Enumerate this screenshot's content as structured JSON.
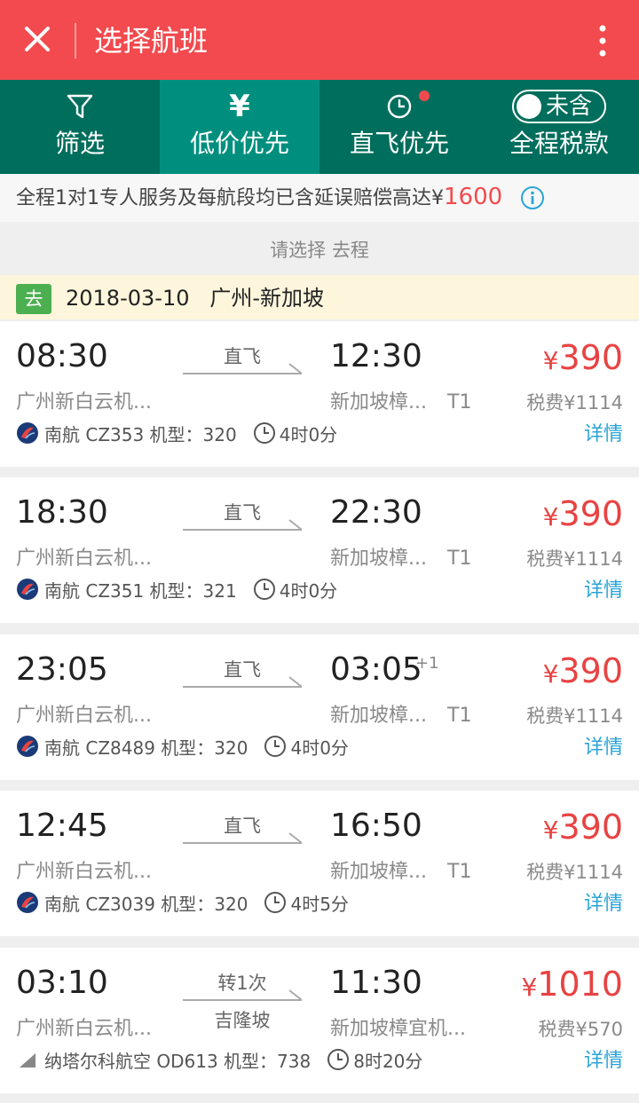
{
  "header": {
    "title": "选择航班"
  },
  "tabs": [
    {
      "label": "筛选",
      "icon": "filter-icon"
    },
    {
      "label": "低价优先",
      "icon": "yen-icon",
      "glyph": "¥"
    },
    {
      "label": "直飞优先",
      "icon": "clock-icon"
    },
    {
      "label": "全程税款",
      "toggle_label": "未含"
    }
  ],
  "notice": {
    "text": "全程1对1专人服务及每航段均已含延误赔偿高达¥",
    "amount": "1600"
  },
  "section_label": "请选择 去程",
  "route": {
    "badge": "去",
    "text": "2018-03-10   广州-新加坡"
  },
  "flights": [
    {
      "dep_time": "08:30",
      "arr_time": "12:30",
      "plus": "",
      "dep_airport": "广州新白云机...",
      "arr_airport": "新加坡樟...",
      "terminal": "T1",
      "mid_top": "直飞",
      "mid_bottom": "",
      "currency": "¥",
      "price": "390",
      "tax": "税费¥1114",
      "airline": "南航",
      "flight_no": "CZ353 机型：320",
      "duration": "4时0分",
      "detail": "详情"
    },
    {
      "dep_time": "18:30",
      "arr_time": "22:30",
      "plus": "",
      "dep_airport": "广州新白云机...",
      "arr_airport": "新加坡樟...",
      "terminal": "T1",
      "mid_top": "直飞",
      "mid_bottom": "",
      "currency": "¥",
      "price": "390",
      "tax": "税费¥1114",
      "airline": "南航",
      "flight_no": "CZ351 机型：321",
      "duration": "4时0分",
      "detail": "详情"
    },
    {
      "dep_time": "23:05",
      "arr_time": "03:05",
      "plus": "+1",
      "dep_airport": "广州新白云机...",
      "arr_airport": "新加坡樟...",
      "terminal": "T1",
      "mid_top": "直飞",
      "mid_bottom": "",
      "currency": "¥",
      "price": "390",
      "tax": "税费¥1114",
      "airline": "南航",
      "flight_no": "CZ8489 机型：320",
      "duration": "4时0分",
      "detail": "详情"
    },
    {
      "dep_time": "12:45",
      "arr_time": "16:50",
      "plus": "",
      "dep_airport": "广州新白云机...",
      "arr_airport": "新加坡樟...",
      "terminal": "T1",
      "mid_top": "直飞",
      "mid_bottom": "",
      "currency": "¥",
      "price": "390",
      "tax": "税费¥1114",
      "airline": "南航",
      "flight_no": "CZ3039 机型：320",
      "duration": "4时5分",
      "detail": "详情"
    },
    {
      "dep_time": "03:10",
      "arr_time": "11:30",
      "plus": "",
      "dep_airport": "广州新白云机...",
      "arr_airport": "新加坡樟宜机...",
      "terminal": "",
      "mid_top": "转1次",
      "mid_bottom": "吉隆坡",
      "currency": "¥",
      "price": "1010",
      "tax": "税费¥570",
      "airline": "纳塔尔科航空",
      "flight_no": "OD613 机型：738",
      "duration": "8时20分",
      "detail": "详情"
    }
  ],
  "colors": {
    "header": "#f24a4e",
    "tabs": "#006e5c",
    "tab_active": "#008f7e",
    "price": "#e84343",
    "link": "#2aa4d6"
  }
}
